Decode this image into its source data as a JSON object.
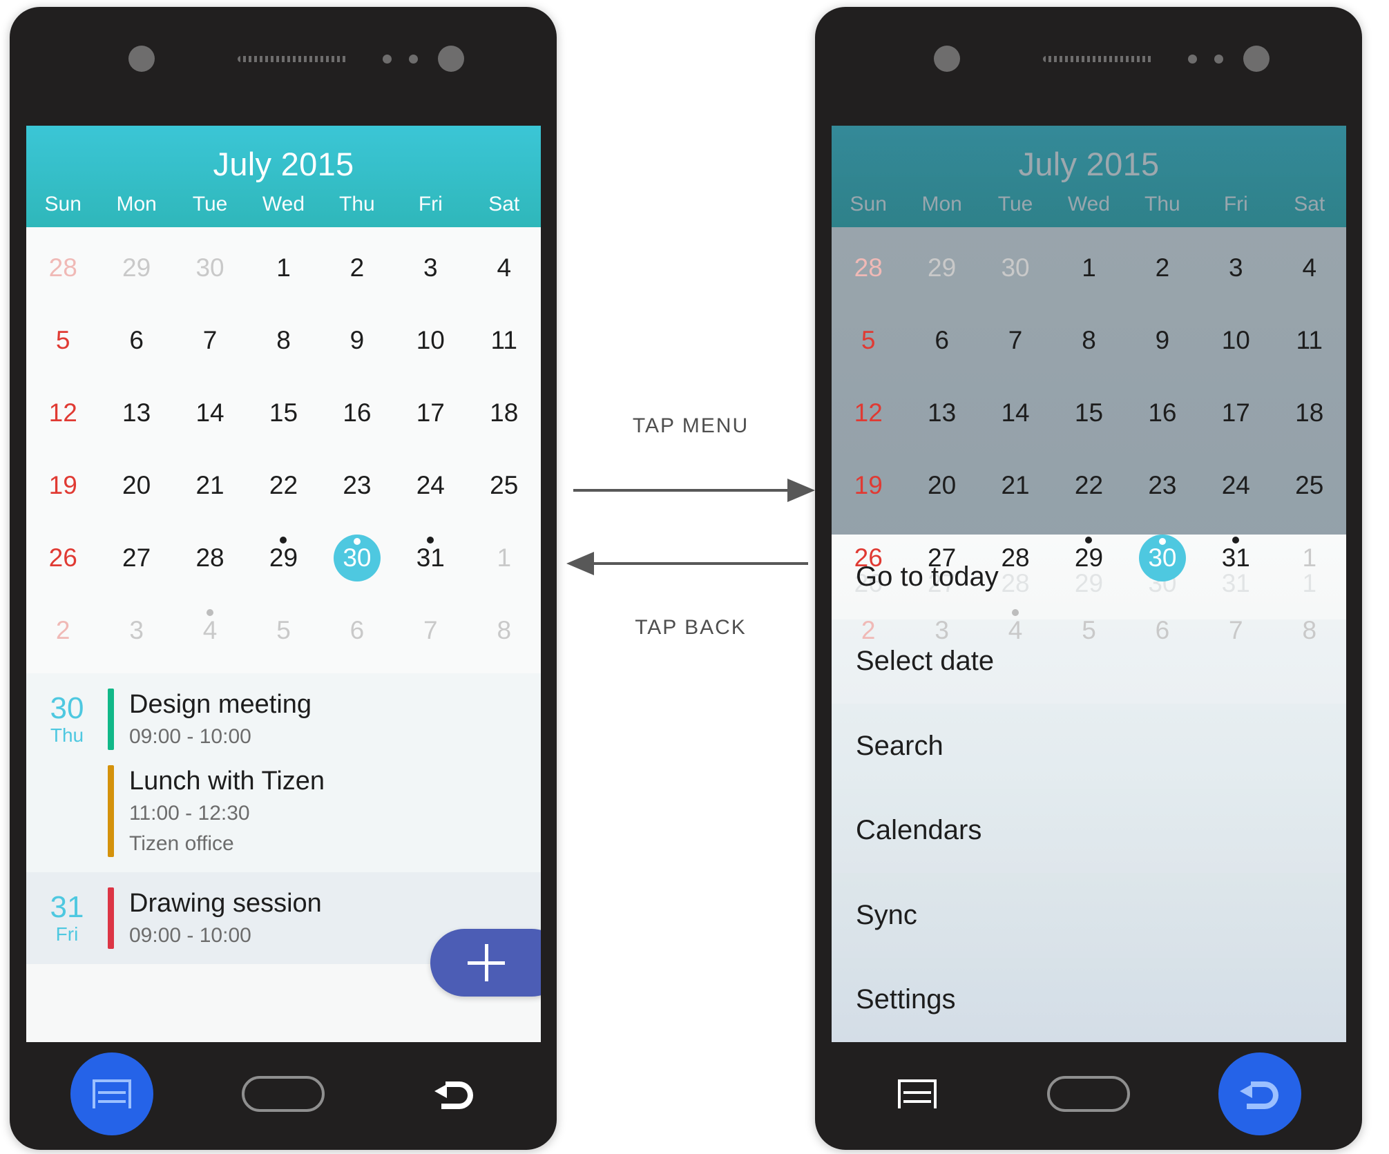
{
  "calendar": {
    "title": "July 2015",
    "weekdays": [
      "Sun",
      "Mon",
      "Tue",
      "Wed",
      "Thu",
      "Fri",
      "Sat"
    ],
    "weeks": [
      [
        {
          "n": "28",
          "muted": true,
          "sun": true
        },
        {
          "n": "29",
          "muted": true
        },
        {
          "n": "30",
          "muted": true
        },
        {
          "n": "1"
        },
        {
          "n": "2"
        },
        {
          "n": "3"
        },
        {
          "n": "4"
        }
      ],
      [
        {
          "n": "5",
          "sun": true
        },
        {
          "n": "6"
        },
        {
          "n": "7"
        },
        {
          "n": "8"
        },
        {
          "n": "9"
        },
        {
          "n": "10"
        },
        {
          "n": "11"
        }
      ],
      [
        {
          "n": "12",
          "sun": true
        },
        {
          "n": "13"
        },
        {
          "n": "14"
        },
        {
          "n": "15"
        },
        {
          "n": "16"
        },
        {
          "n": "17"
        },
        {
          "n": "18"
        }
      ],
      [
        {
          "n": "19",
          "sun": true
        },
        {
          "n": "20"
        },
        {
          "n": "21"
        },
        {
          "n": "22"
        },
        {
          "n": "23"
        },
        {
          "n": "24"
        },
        {
          "n": "25"
        }
      ],
      [
        {
          "n": "26",
          "sun": true
        },
        {
          "n": "27"
        },
        {
          "n": "28"
        },
        {
          "n": "29",
          "dot": true
        },
        {
          "n": "30",
          "dot": true,
          "selected": true
        },
        {
          "n": "31",
          "dot": true
        },
        {
          "n": "1",
          "muted": true
        }
      ],
      [
        {
          "n": "2",
          "muted": true,
          "sun": true
        },
        {
          "n": "3",
          "muted": true
        },
        {
          "n": "4",
          "muted": true,
          "dot": true
        },
        {
          "n": "5",
          "muted": true
        },
        {
          "n": "6",
          "muted": true
        },
        {
          "n": "7",
          "muted": true
        },
        {
          "n": "8",
          "muted": true
        }
      ]
    ],
    "selected_day": "30",
    "accent_color": "#4ec8e0",
    "header_color": "#35c0cd",
    "sunday_color": "#e03a33"
  },
  "events": {
    "groups": [
      {
        "day": "30",
        "weekday": "Thu",
        "items": [
          {
            "title": "Design meeting",
            "time": "09:00 - 10:00",
            "location": "",
            "color": "#11b888"
          },
          {
            "title": "Lunch with Tizen",
            "time": "11:00 - 12:30",
            "location": "Tizen office",
            "color": "#d4920b"
          }
        ]
      },
      {
        "day": "31",
        "weekday": "Fri",
        "items": [
          {
            "title": "Drawing session",
            "time": "09:00 - 10:00",
            "location": "",
            "color": "#dc3545"
          }
        ]
      }
    ],
    "add_button_label": "+",
    "add_button_color": "#4c5db5"
  },
  "menu": {
    "items": [
      {
        "label": "Go to today"
      },
      {
        "label": "Select date"
      },
      {
        "label": "Search"
      },
      {
        "label": "Calendars"
      },
      {
        "label": "Sync"
      },
      {
        "label": "Settings"
      }
    ],
    "ghost_row": [
      "26",
      "27",
      "28",
      "29",
      "30",
      "31",
      "1"
    ]
  },
  "navbar": {
    "menu_label": "menu-icon",
    "home_label": "home-icon",
    "back_label": "back-icon",
    "active_color": "#2563e8"
  },
  "annotations": {
    "tap_menu": "TAP MENU",
    "tap_back": "TAP BACK"
  }
}
